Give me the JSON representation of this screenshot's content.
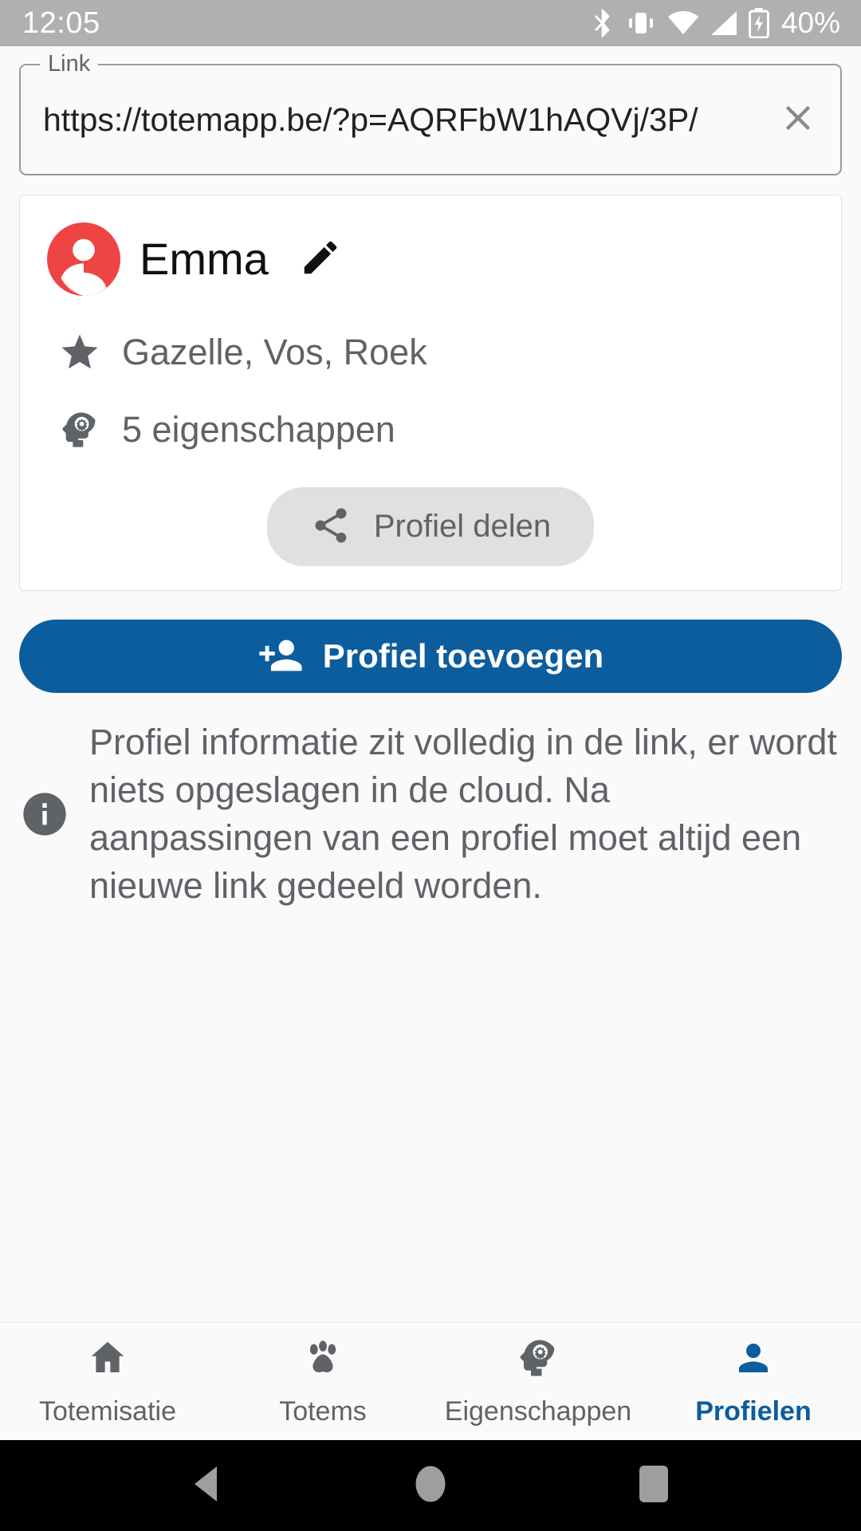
{
  "status_bar": {
    "time": "12:05",
    "battery": "40%",
    "icons": [
      "bluetooth-icon",
      "vibrate-icon",
      "wifi-icon",
      "cell-signal-icon",
      "battery-icon"
    ]
  },
  "link_field": {
    "legend": "Link",
    "value": "https://totemapp.be/?p=AQRFbW1hAQVj/3P/",
    "clear_icon": "close-icon"
  },
  "profile_card": {
    "avatar_icon": "account-circle-icon",
    "avatar_color": "#ef4444",
    "name": "Emma",
    "edit_icon": "pencil-icon",
    "totems_icon": "star-icon",
    "totems": "Gazelle, Vos, Roek",
    "properties_icon": "psychology-icon",
    "properties": "5 eigenschappen",
    "share_icon": "share-icon",
    "share_label": "Profiel delen"
  },
  "add_button": {
    "icon": "person-add-icon",
    "label": "Profiel toevoegen",
    "color": "#0b5d9e"
  },
  "note": {
    "icon": "info-icon",
    "text": "Profiel informatie zit volledig in de link, er wordt niets opgeslagen in de cloud. Na aanpassingen van een profiel moet altijd een nieuwe link gedeeld worden."
  },
  "bottom_nav": {
    "active_color": "#0b5d9e",
    "items": [
      {
        "label": "Totemisatie",
        "icon": "home-icon",
        "active": false
      },
      {
        "label": "Totems",
        "icon": "paw-icon",
        "active": false
      },
      {
        "label": "Eigenschappen",
        "icon": "psychology-icon",
        "active": false
      },
      {
        "label": "Profielen",
        "icon": "person-icon",
        "active": true
      }
    ]
  },
  "system_bar": {
    "back": "back-triangle-icon",
    "home": "home-circle-icon",
    "recents": "recents-square-icon"
  }
}
